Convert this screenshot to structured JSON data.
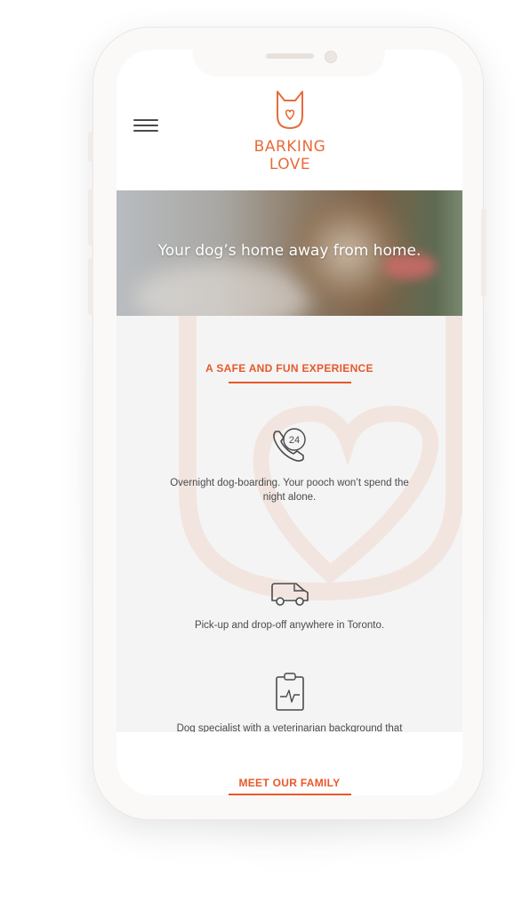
{
  "brand": {
    "name": "BARKING LOVE",
    "color": "#e86b3a",
    "accent": "#e8582a"
  },
  "header": {
    "menu_icon": "hamburger-menu-icon",
    "logo_icon": "dog-head-logo-icon"
  },
  "hero": {
    "tagline": "Your dog’s home away from home."
  },
  "experience": {
    "title": "A SAFE AND FUN EXPERIENCE",
    "features": [
      {
        "icon": "phone-24-icon",
        "badge": "24",
        "text": "Overnight dog-boarding. Your pooch won’t spend the night alone."
      },
      {
        "icon": "van-icon",
        "text": "Pick-up and drop-off anywhere in Toronto."
      },
      {
        "icon": "clipboard-heartbeat-icon",
        "text": "Dog specialist with a veterinarian background that you can trust."
      }
    ]
  },
  "family": {
    "title": "MEET OUR FAMILY"
  }
}
